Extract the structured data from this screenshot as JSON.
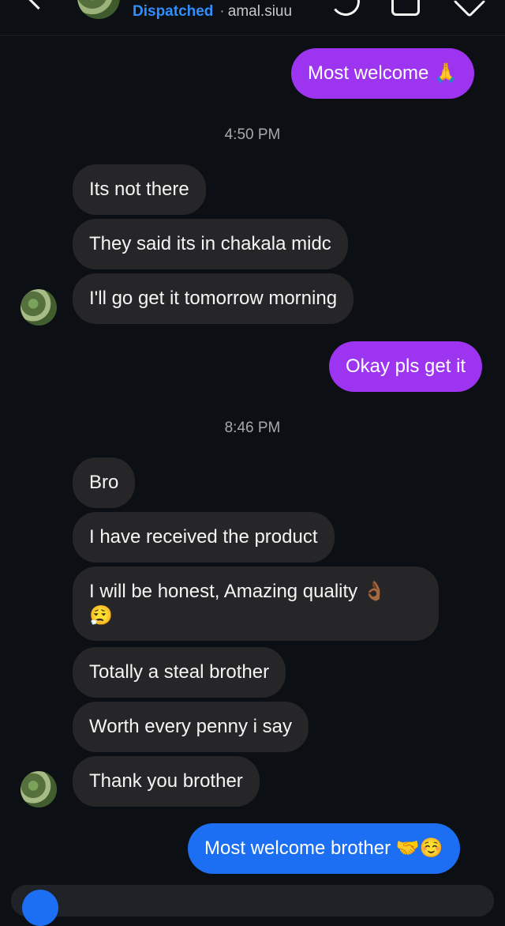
{
  "header": {
    "status": "Dispatched",
    "separator": "·",
    "username": "amal.siuu"
  },
  "messages": {
    "m1": "Most welcome 🙏",
    "t1": "4:50 PM",
    "m2": "Its not there",
    "m3": "They said its in chakala midc",
    "m4": "I'll go get it tomorrow morning",
    "m5": "Okay pls get it",
    "t2": "8:46 PM",
    "m6": "Bro",
    "m7": "I have received the product",
    "m8_line1": "I will be honest, Amazing quality 👌🏾",
    "m8_line2": "😮‍💨",
    "m9": "Totally a steal brother",
    "m10": "Worth every penny i say",
    "m11": "Thank you brother",
    "m12": "Most welcome brother 🤝☺️"
  },
  "icons": {
    "back": "chevron-left-icon",
    "call": "phone-icon",
    "video": "video-call-icon",
    "info": "heart-icon"
  },
  "colors": {
    "background": "#0c1014",
    "incoming_bubble": "#262628",
    "outgoing_purple": "#9d34f0",
    "outgoing_blue": "#1c6ff3",
    "status_text": "#2e8fff"
  }
}
